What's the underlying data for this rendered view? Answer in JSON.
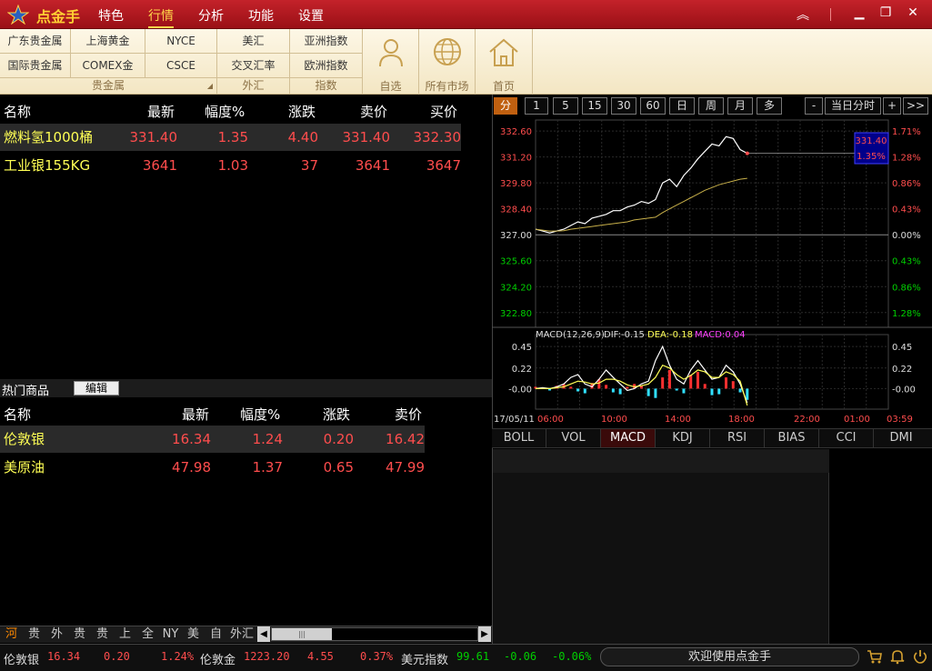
{
  "app": {
    "name": "点金手"
  },
  "menu": [
    "特色",
    "行情",
    "分析",
    "功能",
    "设置"
  ],
  "toolbar": {
    "precious_metals": {
      "row1": [
        "广东贵金属",
        "上海黄金",
        "NYCE"
      ],
      "row2": [
        "国际贵金属",
        "COMEX金",
        "CSCE"
      ],
      "group": "贵金属"
    },
    "forex": {
      "row1": "美汇",
      "row2": "交叉汇率",
      "group": "外汇"
    },
    "index": {
      "row1": "亚洲指数",
      "row2": "欧洲指数",
      "group": "指数"
    },
    "buttons": [
      {
        "label": "自选",
        "icon": "user-icon"
      },
      {
        "label": "所有市场",
        "icon": "globe-icon"
      },
      {
        "label": "首页",
        "icon": "home-icon"
      }
    ]
  },
  "quotes": {
    "headers": [
      "名称",
      "最新",
      "幅度%",
      "涨跌",
      "卖价",
      "买价"
    ],
    "rows": [
      {
        "name": "燃料氢1000桶",
        "last": "331.40",
        "pct": "1.35",
        "chg": "4.40",
        "ask": "331.40",
        "bid": "332.30"
      },
      {
        "name": "工业银155KG",
        "last": "3641",
        "pct": "1.03",
        "chg": "37",
        "ask": "3641",
        "bid": "3647"
      }
    ]
  },
  "hot": {
    "title": "热门商品",
    "edit": "编辑",
    "headers": [
      "名称",
      "最新",
      "幅度%",
      "涨跌",
      "卖价"
    ],
    "rows": [
      {
        "name": "伦敦银",
        "last": "16.34",
        "pct": "1.24",
        "chg": "0.20",
        "ask": "16.42"
      },
      {
        "name": "美原油",
        "last": "47.98",
        "pct": "1.37",
        "chg": "0.65",
        "ask": "47.99"
      }
    ]
  },
  "periods": [
    "分",
    "1",
    "5",
    "15",
    "30",
    "60",
    "日",
    "周",
    "月",
    "多"
  ],
  "chart_controls": {
    "minus": "-",
    "mode": "当日分时",
    "plus": "+",
    "more": ">>"
  },
  "chart_data": {
    "type": "line",
    "price_ticks": [
      "332.60",
      "331.20",
      "329.80",
      "328.40",
      "327.00",
      "325.60",
      "324.20",
      "322.80"
    ],
    "pct_ticks": [
      "1.71%",
      "1.28%",
      "0.86%",
      "0.43%",
      "0.00%",
      "0.43%",
      "0.86%",
      "1.28%"
    ],
    "base_price": 327.0,
    "ylim": [
      322.2,
      333.0
    ],
    "current_price": "331.40",
    "current_pct": "1.35%",
    "x": [
      "06:00",
      "06:30",
      "07:00",
      "07:30",
      "08:00",
      "08:30",
      "09:00",
      "09:30",
      "10:00",
      "10:30",
      "11:00",
      "11:30",
      "12:00",
      "12:30",
      "13:00",
      "13:30",
      "14:00",
      "14:15",
      "14:30",
      "15:00",
      "15:30",
      "16:00",
      "16:30",
      "17:00",
      "17:15",
      "17:30",
      "17:45",
      "18:00",
      "18:10",
      "18:20",
      "18:30"
    ],
    "series": [
      {
        "values": [
          327.3,
          327.2,
          327.1,
          327.2,
          327.3,
          327.5,
          327.7,
          327.6,
          327.9,
          328.0,
          328.1,
          328.3,
          328.3,
          328.5,
          328.6,
          328.8,
          328.7,
          328.9,
          329.8,
          330.0,
          329.6,
          330.2,
          330.6,
          331.1,
          331.5,
          331.9,
          331.8,
          332.3,
          332.2,
          331.6,
          331.4
        ]
      },
      {
        "values": [
          327.3,
          327.25,
          327.2,
          327.2,
          327.22,
          327.3,
          327.35,
          327.4,
          327.45,
          327.5,
          327.55,
          327.6,
          327.65,
          327.7,
          327.8,
          327.85,
          327.9,
          327.95,
          328.2,
          328.4,
          328.6,
          328.8,
          329.0,
          329.2,
          329.4,
          329.55,
          329.7,
          329.8,
          329.9,
          330.0,
          330.05
        ]
      }
    ],
    "x_ticks": [
      "17/05/11",
      "06:00",
      "10:00",
      "14:00",
      "18:00",
      "22:00",
      "01:00",
      "03:59"
    ],
    "macd": {
      "label": "MACD(12,26,9)",
      "dif_label": "DIF:-0.15",
      "dea_label": "DEA:-0.18",
      "macd_label": "MACD:0.04",
      "ticks": [
        "0.45",
        "0.22",
        "-0.00"
      ],
      "ylim": [
        -0.2,
        0.5
      ],
      "bars": [
        0.02,
        0.01,
        -0.02,
        0.03,
        0.05,
        0.02,
        -0.03,
        -0.05,
        0.06,
        0.1,
        0.04,
        -0.04,
        -0.06,
        0.02,
        0.05,
        0.03,
        -0.08,
        -0.1,
        0.12,
        0.2,
        -0.02,
        -0.05,
        0.15,
        0.18,
        0.05,
        -0.07,
        -0.06,
        0.12,
        0.08,
        -0.04,
        -0.12
      ],
      "dif": [
        0.0,
        0.01,
        0.0,
        0.02,
        0.05,
        0.12,
        0.15,
        0.05,
        0.02,
        0.1,
        0.2,
        0.12,
        0.05,
        -0.02,
        0.0,
        0.05,
        0.08,
        0.3,
        0.45,
        0.25,
        0.1,
        0.05,
        0.2,
        0.3,
        0.2,
        0.1,
        0.12,
        0.25,
        0.18,
        0.05,
        -0.15
      ],
      "dea": [
        0.0,
        0.0,
        0.0,
        0.01,
        0.02,
        0.05,
        0.08,
        0.07,
        0.05,
        0.06,
        0.1,
        0.1,
        0.08,
        0.04,
        0.02,
        0.03,
        0.05,
        0.12,
        0.25,
        0.22,
        0.15,
        0.1,
        0.14,
        0.2,
        0.18,
        0.12,
        0.12,
        0.18,
        0.15,
        0.08,
        -0.18
      ]
    }
  },
  "indicator_tabs": [
    "BOLL",
    "VOL",
    "MACD",
    "KDJ",
    "RSI",
    "BIAS",
    "CCI",
    "DMI"
  ],
  "market_tabs": [
    "河",
    "贵",
    "外",
    "贵",
    "贵",
    "上",
    "全",
    "NY",
    "美",
    "自",
    "外汇"
  ],
  "status": {
    "items": [
      {
        "name": "伦敦银",
        "last": "16.34",
        "chg": "0.20",
        "pct": "1.24%"
      },
      {
        "name": "伦敦金",
        "last": "1223.20",
        "chg": "4.55",
        "pct": "0.37%"
      },
      {
        "name": "美元指数",
        "last": "99.61",
        "chg": "-0.06",
        "pct": "-0.06%"
      }
    ],
    "welcome": "欢迎使用点金手"
  },
  "colors": {
    "up": "#ff4d4d",
    "down": "#00d000",
    "name": "#ffff55",
    "title_bg": "#b0181e",
    "accent": "#ffd54a"
  }
}
